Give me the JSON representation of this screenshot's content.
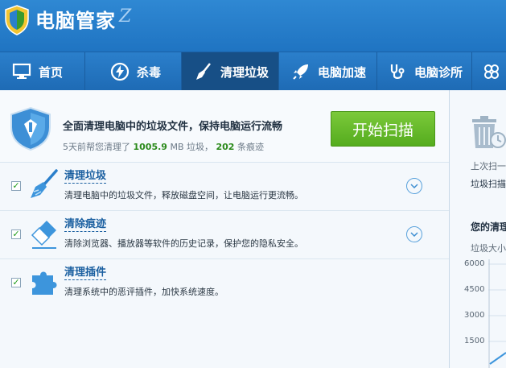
{
  "app": {
    "title": "电脑管家",
    "title_mark": "Z"
  },
  "nav": {
    "tabs": [
      {
        "label": "首页",
        "icon": "monitor-icon"
      },
      {
        "label": "杀毒",
        "icon": "lightning-shield-icon"
      },
      {
        "label": "清理垃圾",
        "icon": "broom-icon",
        "active": true
      },
      {
        "label": "电脑加速",
        "icon": "rocket-icon"
      },
      {
        "label": "电脑诊所",
        "icon": "stethoscope-icon"
      },
      {
        "label": "",
        "icon": "toolbox-icon"
      }
    ]
  },
  "header": {
    "headline": "全面清理电脑中的垃圾文件，保持电脑运行流畅",
    "sub_prefix": "5天前帮您清理了",
    "size_value": "1005.9",
    "size_unit": "MB 垃圾，",
    "trace_count": "202",
    "trace_suffix": "条痕迹",
    "scan_button": "开始扫描"
  },
  "items": [
    {
      "title": "清理垃圾",
      "desc": "清理电脑中的垃圾文件，释放磁盘空间，让电脑运行更流畅。",
      "checked": true,
      "icon": "broom-icon"
    },
    {
      "title": "清除痕迹",
      "desc": "清除浏览器、播放器等软件的历史记录，保护您的隐私安全。",
      "checked": true,
      "icon": "eraser-icon"
    },
    {
      "title": "清理插件",
      "desc": "清理系统中的恶评插件，加快系统速度。",
      "checked": true,
      "icon": "puzzle-icon"
    }
  ],
  "right": {
    "last_scan": "上次扫一",
    "scan_label": "垃圾扫描",
    "section_title": "您的清理",
    "axis_label": "垃圾大小",
    "ticks": [
      "6000",
      "4500",
      "3000",
      "1500"
    ]
  },
  "colors": {
    "brand": "#2a80cc",
    "accent_green": "#5cb526",
    "nav_active": "#174f86"
  }
}
